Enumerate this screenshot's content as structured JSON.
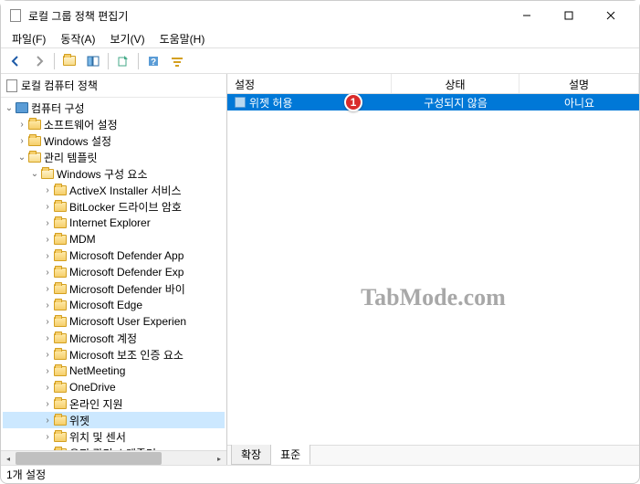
{
  "window": {
    "title": "로컬 그룹 정책 편집기"
  },
  "menu": {
    "file": "파일(F)",
    "action": "동작(A)",
    "view": "보기(V)",
    "help": "도움말(H)"
  },
  "tree": {
    "root": "로컬 컴퓨터 정책",
    "computer_config": "컴퓨터 구성",
    "software": "소프트웨어 설정",
    "windows_settings": "Windows 설정",
    "admin_templates": "관리 템플릿",
    "windows_components": "Windows 구성 요소",
    "items": [
      "ActiveX Installer 서비스",
      "BitLocker 드라이브 암호",
      "Internet Explorer",
      "MDM",
      "Microsoft Defender App",
      "Microsoft Defender Exp",
      "Microsoft Defender 바이",
      "Microsoft Edge",
      "Microsoft User Experien",
      "Microsoft 계정",
      "Microsoft 보조 인증 요소",
      "NetMeeting",
      "OneDrive",
      "온라인 지원",
      "위젯",
      "위치 및 센서",
      "유지 관리 스케줄러"
    ],
    "selected_index": 14
  },
  "list": {
    "columns": {
      "setting": "설정",
      "state": "상태",
      "description": "설명"
    },
    "row": {
      "name": "위젯 허용",
      "state": "구성되지 않음",
      "description": "아니요"
    }
  },
  "badge": "1",
  "tabs": {
    "extended": "확장",
    "standard": "표준"
  },
  "statusbar": "1개 설정",
  "watermark": "TabMode.com"
}
